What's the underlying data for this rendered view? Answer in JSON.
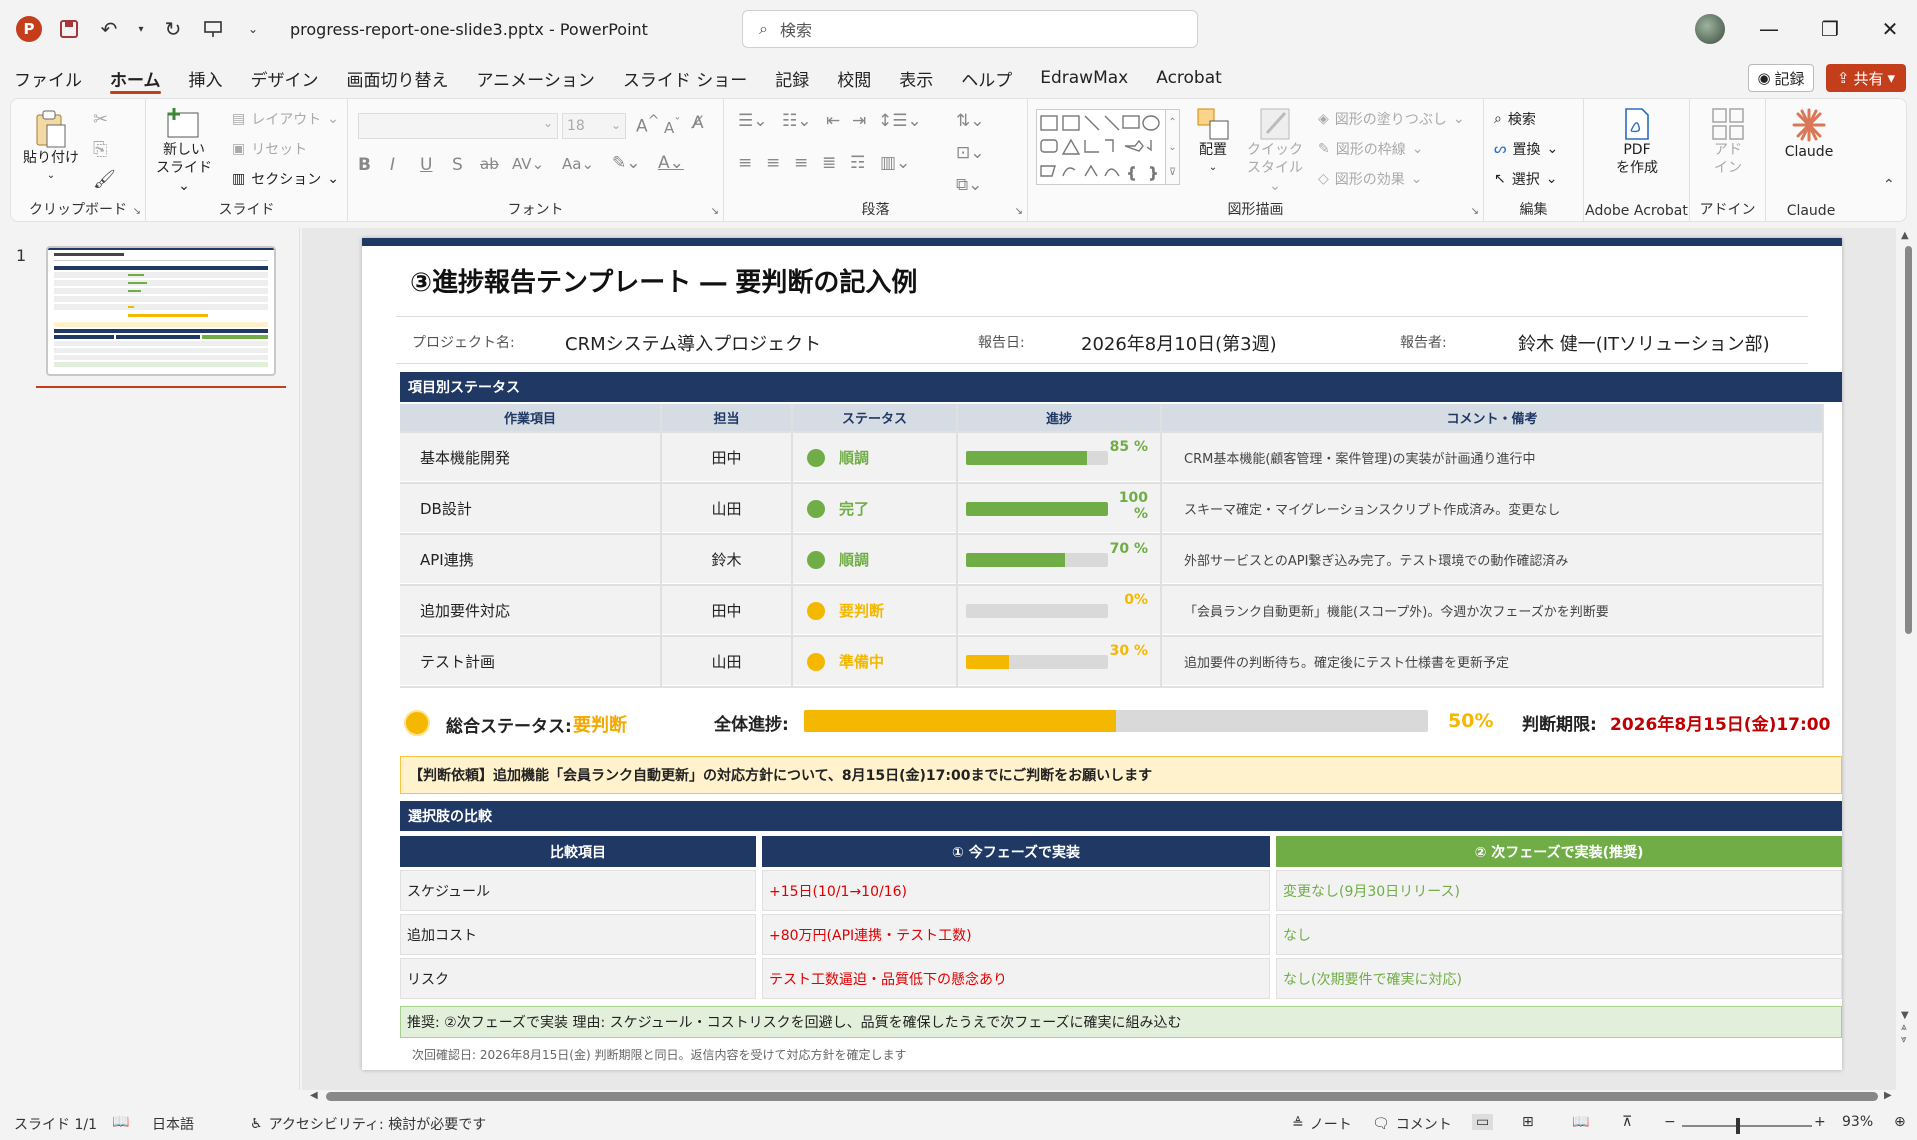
{
  "app": {
    "filename": "progress-report-one-slide3.pptx",
    "app_name": "PowerPoint",
    "search_placeholder": "検索",
    "record_label": "記録",
    "share_label": "共有"
  },
  "menu_tabs": [
    "ファイル",
    "ホーム",
    "挿入",
    "デザイン",
    "画面切り替え",
    "アニメーション",
    "スライド ショー",
    "記録",
    "校閲",
    "表示",
    "ヘルプ",
    "EdrawMax",
    "Acrobat"
  ],
  "active_tab": "ホーム",
  "ribbon": {
    "clipboard": {
      "label": "クリップボード",
      "paste": "貼り付け"
    },
    "slides": {
      "label": "スライド",
      "new_slide_1": "新しい",
      "new_slide_2": "スライド",
      "layout": "レイアウト",
      "reset": "リセット",
      "section": "セクション"
    },
    "font": {
      "label": "フォント",
      "size": "18"
    },
    "paragraph": {
      "label": "段落"
    },
    "drawing": {
      "label": "図形描画",
      "arrange": "配置",
      "quick_style_1": "クイック",
      "quick_style_2": "スタイル",
      "fill": "図形の塗りつぶし",
      "outline": "図形の枠線",
      "effects": "図形の効果"
    },
    "editing": {
      "label": "編集",
      "find": "検索",
      "replace": "置換",
      "select": "選択"
    },
    "acrobat": {
      "label": "Adobe Acrobat",
      "create_pdf_1": "PDF",
      "create_pdf_2": "を作成"
    },
    "addins": {
      "label": "アドイン",
      "btn_1": "アド",
      "btn_2": "イン"
    },
    "claude": {
      "label": "Claude",
      "btn": "Claude"
    }
  },
  "thumbnail": {
    "number": "1"
  },
  "slide": {
    "title": "③進捗報告テンプレート ― 要判断の記入例",
    "meta": {
      "project_label": "プロジェクト名:",
      "project_value": "CRMシステム導入プロジェクト",
      "date_label": "報告日:",
      "date_value": "2026年8月10日(第3週)",
      "reporter_label": "報告者:",
      "reporter_value": "鈴木 健一(ITソリューション部)"
    },
    "status_section_title": "項目別ステータス",
    "status_headers": [
      "作業項目",
      "担当",
      "ステータス",
      "進捗",
      "コメント・備考"
    ],
    "status_rows": [
      {
        "item": "基本機能開発",
        "owner": "田中",
        "status": "順調",
        "color": "#70ad47",
        "progress": 85,
        "pct": "85 %",
        "comment": "CRM基本機能(顧客管理・案件管理)の実装が計画通り進行中"
      },
      {
        "item": "DB設計",
        "owner": "山田",
        "status": "完了",
        "color": "#70ad47",
        "progress": 100,
        "pct": "100 %",
        "comment": "スキーマ確定・マイグレーションスクリプト作成済み。変更なし"
      },
      {
        "item": "API連携",
        "owner": "鈴木",
        "status": "順調",
        "color": "#70ad47",
        "progress": 70,
        "pct": "70 %",
        "comment": "外部サービスとのAPI繋ぎ込み完了。テスト環境での動作確認済み"
      },
      {
        "item": "追加要件対応",
        "owner": "田中",
        "status": "要判断",
        "color": "#f5b800",
        "progress": 0,
        "pct": "0%",
        "comment": "「会員ランク自動更新」機能(スコープ外)。今週か次フェーズかを判断要"
      },
      {
        "item": "テスト計画",
        "owner": "山田",
        "status": "準備中",
        "color": "#f5b800",
        "progress": 30,
        "pct": "30 %",
        "comment": "追加要件の判断待ち。確定後にテスト仕様書を更新予定"
      }
    ],
    "overall": {
      "label": "総合ステータス:",
      "value": "要判断",
      "progress_label": "全体進捗:",
      "progress": 50,
      "progress_text": "50%",
      "deadline_label": "判断期限:",
      "deadline_value": "2026年8月15日(金)17:00"
    },
    "request": "【判断依頼】追加機能「会員ランク自動更新」の対応方針について、8月15日(金)17:00までにご判断をお願いします",
    "compare_section_title": "選択肢の比較",
    "compare_headers": [
      "比較項目",
      "① 今フェーズで実装",
      "② 次フェーズで実装(推奨)"
    ],
    "compare_rows": [
      {
        "item": "スケジュール",
        "opt1": "+15日(10/1→10/16)",
        "opt2": "変更なし(9月30日リリース)"
      },
      {
        "item": "追加コスト",
        "opt1": "+80万円(API連携・テスト工数)",
        "opt2": "なし"
      },
      {
        "item": "リスク",
        "opt1": "テスト工数逼迫・品質低下の懸念あり",
        "opt2": "なし(次期要件で確実に対応)"
      }
    ],
    "recommendation": "推奨: ②次フェーズで実装  理由: スケジュール・コストリスクを回避し、品質を確保したうえで次フェーズに確実に組み込む",
    "footnote": "次回確認日: 2026年8月15日(金)  判断期限と同日。返信内容を受けて対応方針を確定します",
    "colors": {
      "navy": "#1f3864",
      "green": "#70ad47",
      "amber": "#f5b800",
      "red": "#e00000"
    }
  },
  "statusbar": {
    "slide_pos": "スライド 1/1",
    "language": "日本語",
    "accessibility": "アクセシビリティ: 検討が必要です",
    "notes": "ノート",
    "comments": "コメント",
    "zoom": "93%"
  }
}
